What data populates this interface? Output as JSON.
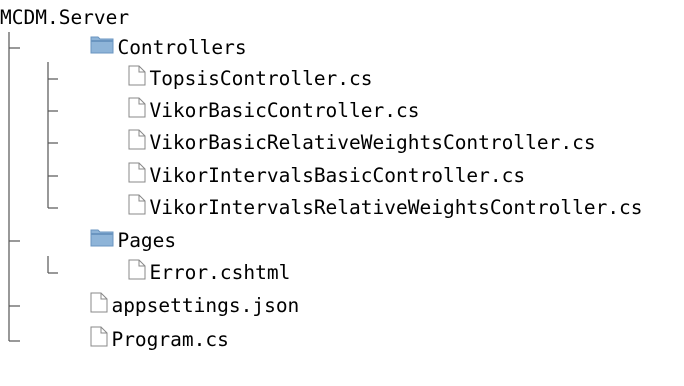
{
  "tree": {
    "root": "MCDM.Server",
    "controllers": {
      "folder": "Controllers",
      "files": [
        "TopsisController.cs",
        "VikorBasicController.cs",
        "VikorBasicRelativeWeightsController.cs",
        "VikorIntervalsBasicController.cs",
        "VikorIntervalsRelativeWeightsController.cs"
      ]
    },
    "pages": {
      "folder": "Pages",
      "files": [
        "Error.cshtml"
      ]
    },
    "root_files": [
      "appsettings.json",
      "Program.cs"
    ]
  },
  "colors": {
    "folder": "#8eb4d8",
    "folder_tab": "#6a95c0",
    "file_outline": "#888888",
    "connector": "#555555"
  },
  "icons": {
    "folder": "folder-icon",
    "file": "file-icon"
  }
}
